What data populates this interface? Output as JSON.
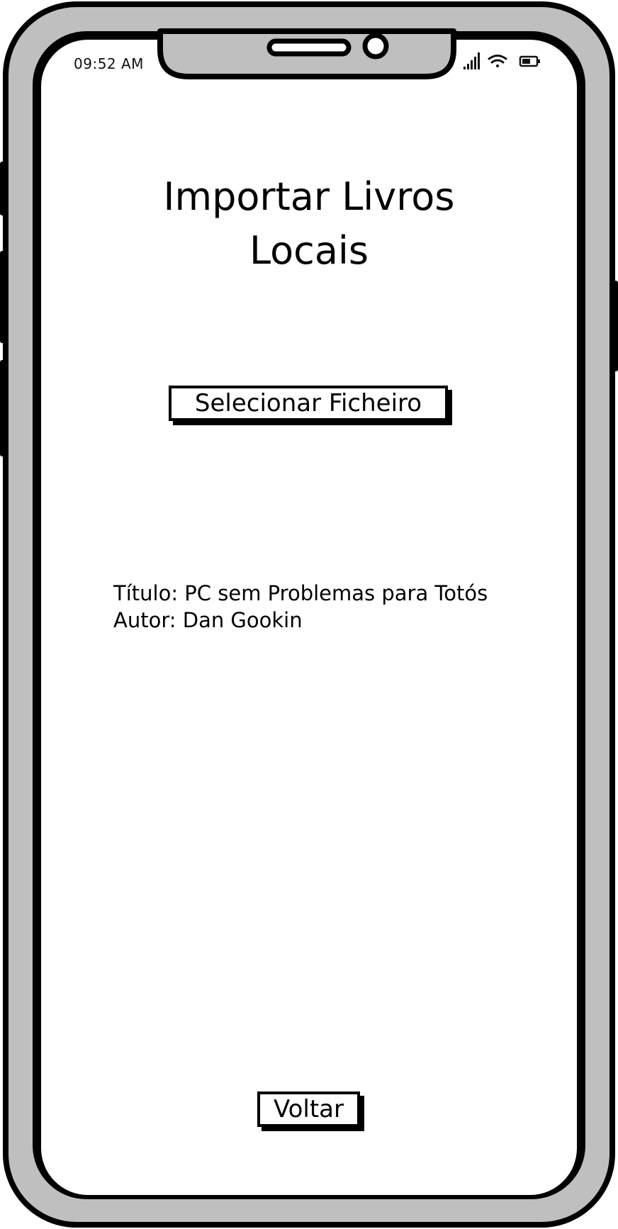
{
  "status_bar": {
    "time": "09:52 AM",
    "icons": [
      "signal-icon",
      "wifi-icon",
      "battery-icon"
    ]
  },
  "page": {
    "title": "Importar Livros Locais"
  },
  "actions": {
    "select_file_label": "Selecionar Ficheiro",
    "back_label": "Voltar"
  },
  "book": {
    "title_line": "Título: PC sem Problemas para Totós",
    "author_line": "Autor: Dan Gookin"
  },
  "colors": {
    "frame": "#bfbfbf",
    "outline": "#000000",
    "screen": "#ffffff"
  }
}
